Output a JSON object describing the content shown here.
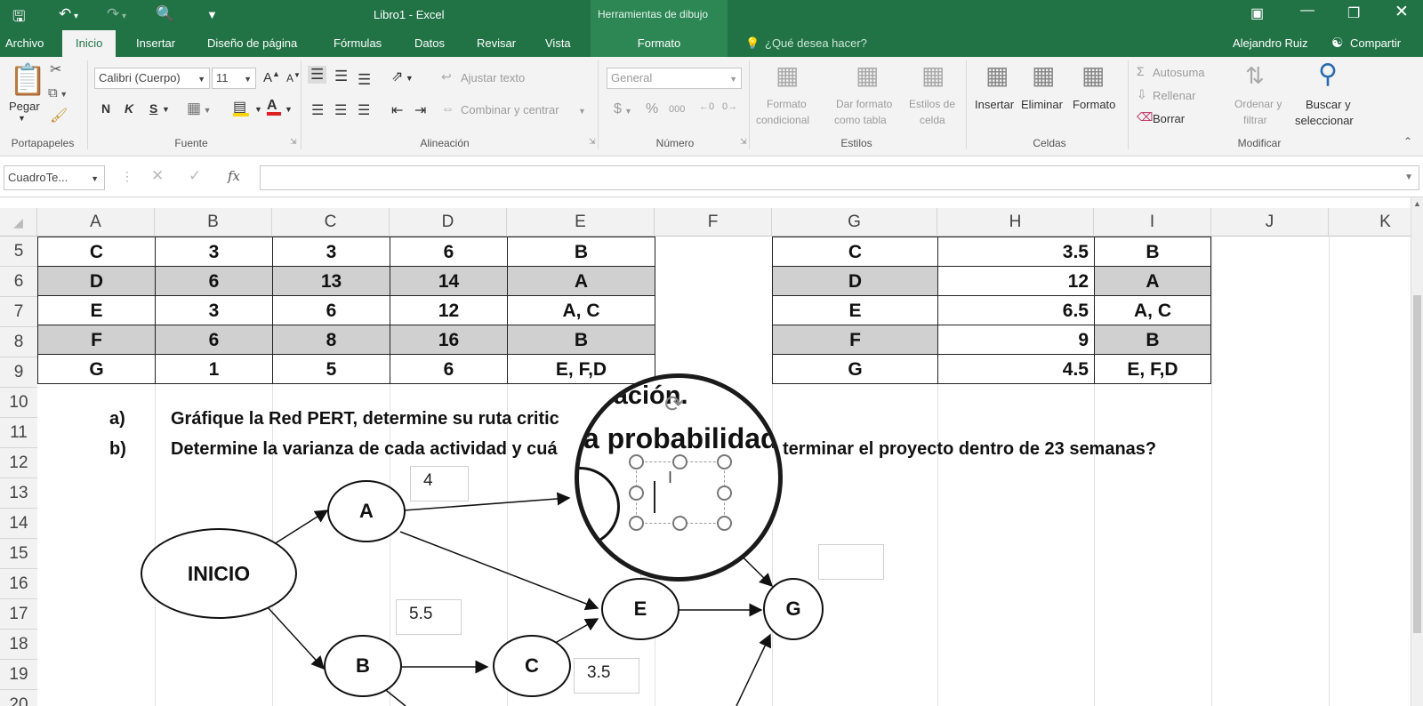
{
  "titlebar": {
    "doc_title": "Libro1 - Excel",
    "context_group": "Herramientas de dibujo",
    "qa_save_icon": "save-icon",
    "qa_undo_icon": "undo-icon",
    "qa_redo_icon": "redo-icon",
    "qa_preview_icon": "print-preview-icon"
  },
  "tabs": [
    "Archivo",
    "Inicio",
    "Insertar",
    "Diseño de página",
    "Fórmulas",
    "Datos",
    "Revisar",
    "Vista"
  ],
  "context_tab": "Formato",
  "tell_me": "¿Qué desea hacer?",
  "user": "Alejandro Ruiz",
  "share": "Compartir",
  "ribbon": {
    "clipboard": {
      "paste": "Pegar",
      "group": "Portapapeles"
    },
    "font": {
      "name": "Calibri (Cuerpo)",
      "size": "11",
      "bold": "N",
      "italic": "K",
      "underline": "S",
      "group": "Fuente"
    },
    "alignment": {
      "wrap": "Ajustar texto",
      "merge": "Combinar y centrar",
      "group": "Alineación"
    },
    "number": {
      "format": "General",
      "currency": "$",
      "percent": "%",
      "thousands": "000",
      "group": "Número"
    },
    "styles": {
      "conditional_1": "Formato",
      "conditional_2": "condicional",
      "table_1": "Dar formato",
      "table_2": "como tabla",
      "cell_1": "Estilos de",
      "cell_2": "celda",
      "group": "Estilos"
    },
    "cells": {
      "insert": "Insertar",
      "delete": "Eliminar",
      "format": "Formato",
      "group": "Celdas"
    },
    "editing": {
      "autosum": "Autosuma",
      "fill": "Rellenar",
      "clear": "Borrar",
      "sort_1": "Ordenar y",
      "sort_2": "filtrar",
      "find_1": "Buscar y",
      "find_2": "seleccionar",
      "group": "Modificar"
    }
  },
  "formula_bar": {
    "name_box": "CuadroTe...",
    "fx": "fx",
    "value": ""
  },
  "columns": [
    "A",
    "B",
    "C",
    "D",
    "E",
    "F",
    "G",
    "H",
    "I",
    "J",
    "K"
  ],
  "rows": [
    "5",
    "6",
    "7",
    "8",
    "9",
    "10",
    "11",
    "12",
    "13",
    "14",
    "15",
    "16",
    "17",
    "18",
    "19",
    "20"
  ],
  "table1": [
    [
      "C",
      "3",
      "3",
      "6",
      "B"
    ],
    [
      "D",
      "6",
      "13",
      "14",
      "A"
    ],
    [
      "E",
      "3",
      "6",
      "12",
      "A, C"
    ],
    [
      "F",
      "6",
      "8",
      "16",
      "B"
    ],
    [
      "G",
      "1",
      "5",
      "6",
      "E, F,D"
    ]
  ],
  "table2": [
    [
      "C",
      "3.5",
      "B"
    ],
    [
      "D",
      "12",
      "A"
    ],
    [
      "E",
      "6.5",
      "A, C"
    ],
    [
      "F",
      "9",
      "B"
    ],
    [
      "G",
      "4.5",
      "E, F,D"
    ]
  ],
  "questions": {
    "a_label": "a)",
    "a_text": "Gráfique la Red PERT,  determine su ruta critic",
    "b_label": "b)",
    "b_text_left": "Determine la varianza de cada actividad y cuá",
    "b_text_right": "terminar el proyecto dentro de 23 semanas?"
  },
  "network": {
    "inicio": "INICIO",
    "a": "A",
    "b": "B",
    "c": "C",
    "e": "E",
    "g": "G",
    "lbl_a": "4",
    "lbl_b": "5.5",
    "lbl_c": "3.5"
  },
  "magnifier": {
    "line1": "duración.",
    "line2": "la probabilidad"
  }
}
